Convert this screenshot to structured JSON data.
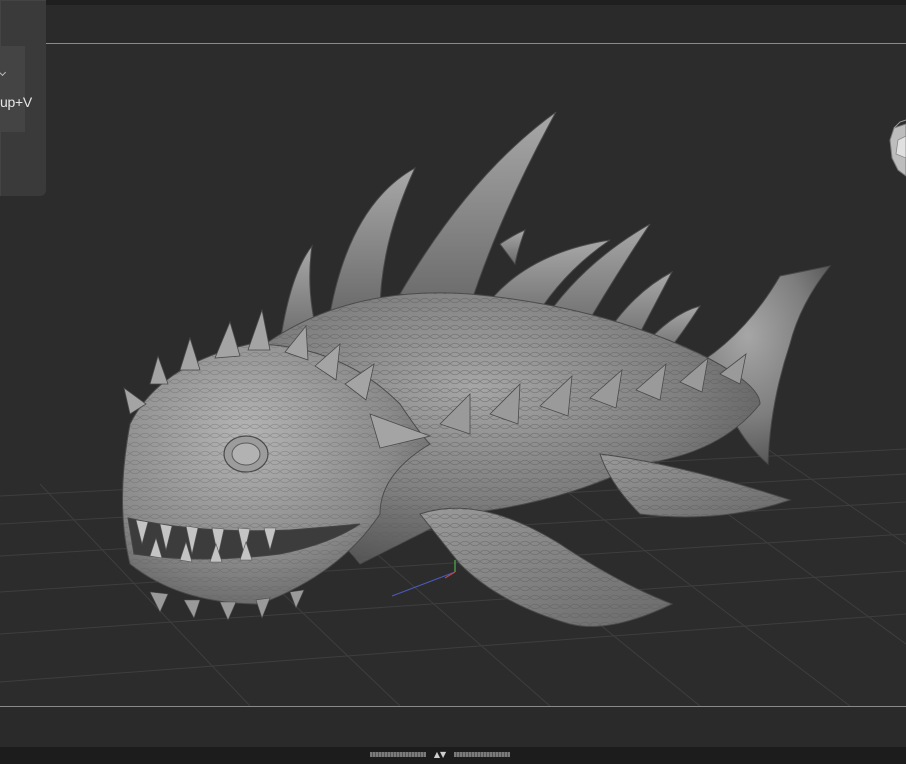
{
  "tool_panel": {
    "shortcut_text": "up+V",
    "caret_icon": "chevron-down-icon"
  },
  "viewport": {
    "model": "sea-creature-sculpt",
    "grid_visible": true,
    "orientation_gizmo_icon": "cube-gizmo-icon"
  },
  "splitter": {
    "arrows": "▲▼",
    "icon": "panel-splitter-icon"
  },
  "colors": {
    "background": "#2c2c2c",
    "panel": "#3a3a3a",
    "grid": "#3f3f3f",
    "clay": "#8e8e8e",
    "rule": "#8a8a8a"
  }
}
